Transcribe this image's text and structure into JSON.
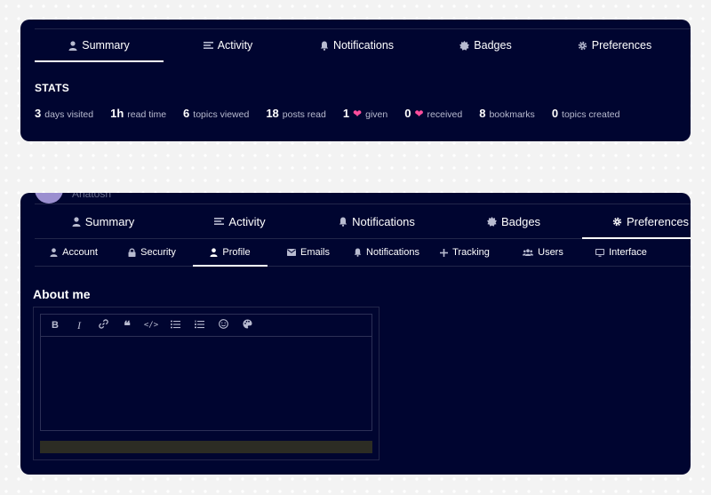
{
  "top_card": {
    "nav": [
      {
        "label": "Summary",
        "icon": "user-icon",
        "active": true
      },
      {
        "label": "Activity",
        "icon": "stream-icon",
        "active": false
      },
      {
        "label": "Notifications",
        "icon": "bell-icon",
        "active": false
      },
      {
        "label": "Badges",
        "icon": "certificate-icon",
        "active": false
      },
      {
        "label": "Preferences",
        "icon": "gear-icon",
        "active": false
      }
    ],
    "stats_title": "STATS",
    "stats": [
      {
        "value": "3",
        "label": "days visited"
      },
      {
        "value": "1h",
        "label": "read time"
      },
      {
        "value": "6",
        "label": "topics viewed"
      },
      {
        "value": "18",
        "label": "posts read"
      },
      {
        "value": "1",
        "label": "given",
        "heart": true
      },
      {
        "value": "0",
        "label": "received",
        "heart": true
      },
      {
        "value": "8",
        "label": "bookmarks"
      },
      {
        "value": "0",
        "label": "topics created"
      }
    ]
  },
  "bottom_card": {
    "username": "Anatosh",
    "nav": [
      {
        "label": "Summary",
        "icon": "user-icon",
        "active": false
      },
      {
        "label": "Activity",
        "icon": "stream-icon",
        "active": false
      },
      {
        "label": "Notifications",
        "icon": "bell-icon",
        "active": false
      },
      {
        "label": "Badges",
        "icon": "certificate-icon",
        "active": false
      },
      {
        "label": "Preferences",
        "icon": "gear-icon",
        "active": true
      }
    ],
    "subnav": [
      {
        "label": "Account",
        "icon": "user-icon",
        "active": false
      },
      {
        "label": "Security",
        "icon": "lock-icon",
        "active": false
      },
      {
        "label": "Profile",
        "icon": "user-icon",
        "active": true
      },
      {
        "label": "Emails",
        "icon": "envelope-icon",
        "active": false
      },
      {
        "label": "Notifications",
        "icon": "bell-icon",
        "active": false
      },
      {
        "label": "Tracking",
        "icon": "plus-icon",
        "active": false
      },
      {
        "label": "Users",
        "icon": "users-icon",
        "active": false
      },
      {
        "label": "Interface",
        "icon": "desktop-icon",
        "active": false
      }
    ],
    "about_title": "About me",
    "editor": {
      "toolbar": [
        "bold-icon",
        "italic-icon",
        "link-icon",
        "quote-icon",
        "code-icon",
        "bullet-list-icon",
        "numbered-list-icon",
        "emoji-icon",
        "palette-icon"
      ],
      "value": ""
    }
  },
  "colors": {
    "card_bg": "#000530",
    "text": "#ffffff",
    "muted": "#b8bbd0",
    "heart": "#ff4d9d",
    "border": "#22264a"
  }
}
